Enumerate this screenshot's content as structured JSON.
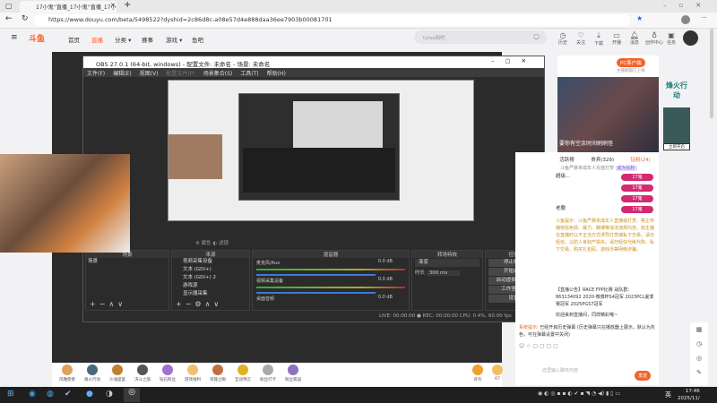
{
  "browser": {
    "tab_title": "17小鬼''直播_17小鬼''直播_17小",
    "url": "https://www.douyu.com/beta/5498522?dyshid=2c86d8c-a08e57d4e888daa36ee7903b00081701"
  },
  "site": {
    "logo": "斗鱼",
    "nav": [
      "首页",
      "直播",
      "分类 ▾",
      "赛事",
      "游戏 ▾",
      "鱼吧"
    ],
    "search_placeholder": "tyloo网吧",
    "top_icons": [
      {
        "icon": "history-icon",
        "label": "历史"
      },
      {
        "icon": "heart-icon",
        "label": "关注"
      },
      {
        "icon": "download-icon",
        "label": "下载"
      },
      {
        "icon": "broadcast-icon",
        "label": "开播"
      },
      {
        "icon": "bell-icon",
        "label": "消息"
      },
      {
        "icon": "bulb-icon",
        "label": "创作中心"
      },
      {
        "icon": "task-icon",
        "label": "任务"
      }
    ],
    "rank_number": "12",
    "rank_label": "主播积分",
    "pc_client": "PC客户端",
    "pc_sub": "主播端都已上线"
  },
  "obs": {
    "title": "OBS 27.0.1 (64-bit, windows) - 配置文件: 未命名 - 场景: 未命名",
    "menu": [
      "文件(F)",
      "编辑(E)",
      "视图(V)",
      "配置文件(P)",
      "场景集合(S)",
      "工具(T)",
      "帮助(H)"
    ],
    "docks": {
      "scenes": "场景",
      "sources": "来源",
      "mixer": "混音器",
      "transitions": "转场特效",
      "controls": "控件"
    },
    "scene_items": [
      "场景"
    ],
    "source_items": [
      "视频采集设备",
      "文本 (GDI+)",
      "文本 (GDI+) 2",
      "游戏源",
      "显示器采集"
    ],
    "mixer_items": [
      {
        "name": "麦克风/Aux",
        "db": "0.0 dB"
      },
      {
        "name": "视频采集设备",
        "db": "0.0 dB"
      },
      {
        "name": "桌面音频",
        "db": "0.0 dB"
      }
    ],
    "transition": "渐变",
    "duration_label": "时长",
    "duration": "300 ms",
    "controls": [
      "停止推流",
      "开始录制",
      "启动虚拟摄像机",
      "工作室模式",
      "设置",
      "退出"
    ],
    "status": {
      "live": "LIVE: 00:00:00",
      "rec": "REC: 00:00:00",
      "cpu": "CPU: 0.4%, 60.00 fps"
    }
  },
  "chat": {
    "tabs": [
      "活跃榜",
      "贵宾(329)",
      "钻粉(24)"
    ],
    "notice": "斗鱼严禁未成年人充值打赏",
    "become_fan": "成为钻粉",
    "fans": [
      {
        "name": "超级…",
        "level": "17鬼"
      },
      {
        "name": "",
        "level": "17鬼"
      },
      {
        "name": "",
        "level": "17鬼"
      },
      {
        "name": "老撒",
        "level": "17鬼"
      }
    ],
    "warning": "斗鱼提示：斗鱼严禁未成年人直播或打赏，禁止传播低俗色情、暴力、赌博等违法违规内容。如主播在直播时以不正当方式诱导打赏或私下交易，请勿轻信，以防人身财产损失。请勿轻信代练代购、私下交易、购买礼包码、游戏币等网络诈骗。",
    "room_info": "【直播公告】RACE FPP比赛 战队群：863134092 2020·微博杯S4冠军 2023PCL夏季赛冠军 2025PGS7冠军",
    "welcome": "欢迎来到直播间，同样精彩哦~",
    "system_label": "系统提示:",
    "system_msg": "已经开启历史弹幕 (历史弹幕只在播放器上展示，默认为灰色，可在弹幕设置中关闭)",
    "input_placeholder": "这里输入聊天内容",
    "send": "发送"
  },
  "gifts": [
    "风雕使者",
    "烽火行动",
    "沙滩盛宴",
    "决斗之旅",
    "钻石粉丝",
    "游戏福利",
    "英雄之眼",
    "互动预言",
    "粉丝打卡",
    "粉丝家园"
  ],
  "gift_right": [
    "背包",
    "67"
  ],
  "banner": {
    "text": "要你有空余时间刷刷怪",
    "ad": "烽火行动",
    "ad_button": "立即开启"
  },
  "taskbar": {
    "time": "17:46",
    "date": "2025/11/",
    "lang": "英"
  }
}
